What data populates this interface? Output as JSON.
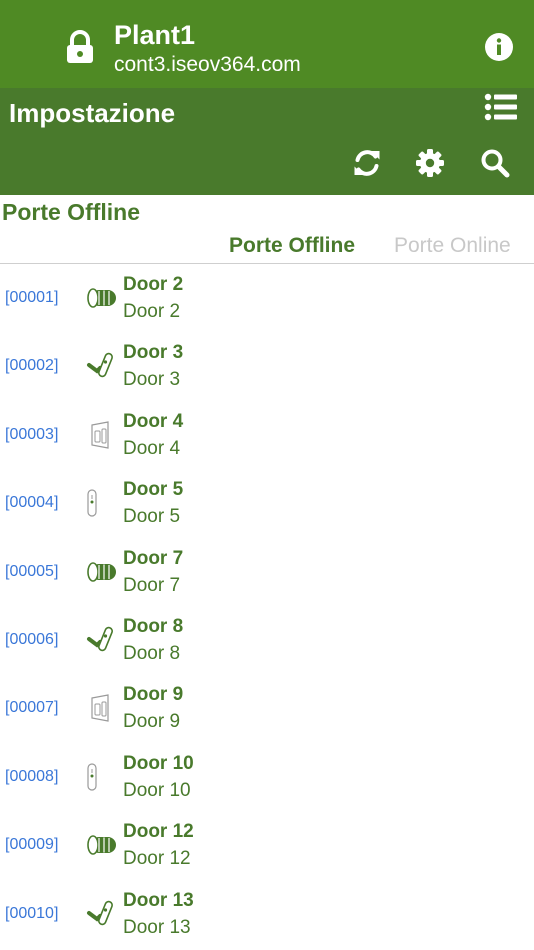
{
  "browser": {
    "title": "Plant1",
    "url": "cont3.iseov364.com",
    "lock_icon": "lock-icon",
    "info_icon": "info-icon"
  },
  "header": {
    "title": "Impostazione",
    "menu_icon": "list-icon",
    "tools": [
      "refresh-icon",
      "gear-icon",
      "search-icon"
    ],
    "color": "#497a2c"
  },
  "section": {
    "title": "Porte Offline"
  },
  "tabs": {
    "offline": "Porte Offline",
    "online": "Porte Online"
  },
  "doors": [
    {
      "code": "[00001]",
      "name": "Door 2",
      "sub": "Door 2",
      "icon": "cylinder"
    },
    {
      "code": "[00002]",
      "name": "Door 3",
      "sub": "Door 3",
      "icon": "handle"
    },
    {
      "code": "[00003]",
      "name": "Door 4",
      "sub": "Door 4",
      "icon": "wall-reader"
    },
    {
      "code": "[00004]",
      "name": "Door 5",
      "sub": "Door 5",
      "icon": "slim-reader"
    },
    {
      "code": "[00005]",
      "name": "Door 7",
      "sub": "Door 7",
      "icon": "cylinder"
    },
    {
      "code": "[00006]",
      "name": "Door 8",
      "sub": "Door 8",
      "icon": "handle"
    },
    {
      "code": "[00007]",
      "name": "Door 9",
      "sub": "Door 9",
      "icon": "wall-reader"
    },
    {
      "code": "[00008]",
      "name": "Door 10",
      "sub": "Door 10",
      "icon": "slim-reader"
    },
    {
      "code": "[00009]",
      "name": "Door 12",
      "sub": "Door 12",
      "icon": "cylinder"
    },
    {
      "code": "[00010]",
      "name": "Door 13",
      "sub": "Door 13",
      "icon": "handle"
    }
  ]
}
